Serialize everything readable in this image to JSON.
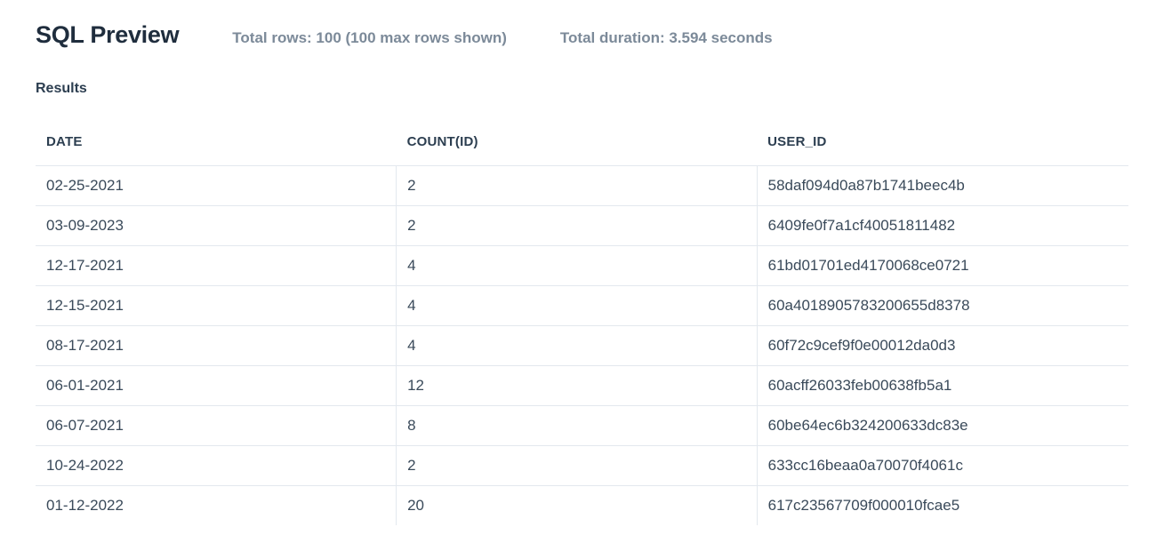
{
  "header": {
    "title": "SQL Preview",
    "total_rows": "Total rows: 100 (100 max rows shown)",
    "total_duration": "Total duration: 3.594 seconds"
  },
  "section": {
    "label": "Results"
  },
  "table": {
    "columns": [
      "DATE",
      "COUNT(ID)",
      "USER_ID"
    ],
    "rows": [
      {
        "date": "02-25-2021",
        "count": "2",
        "user_id": "58daf094d0a87b1741beec4b"
      },
      {
        "date": "03-09-2023",
        "count": "2",
        "user_id": "6409fe0f7a1cf40051811482"
      },
      {
        "date": "12-17-2021",
        "count": "4",
        "user_id": "61bd01701ed4170068ce0721"
      },
      {
        "date": "12-15-2021",
        "count": "4",
        "user_id": "60a4018905783200655d8378"
      },
      {
        "date": "08-17-2021",
        "count": "4",
        "user_id": "60f72c9cef9f0e00012da0d3"
      },
      {
        "date": "06-01-2021",
        "count": "12",
        "user_id": "60acff26033feb00638fb5a1"
      },
      {
        "date": "06-07-2021",
        "count": "8",
        "user_id": "60be64ec6b324200633dc83e"
      },
      {
        "date": "10-24-2022",
        "count": "2",
        "user_id": "633cc16beaa0a70070f4061c"
      },
      {
        "date": "01-12-2022",
        "count": "20",
        "user_id": "617c23567709f000010fcae5"
      }
    ]
  }
}
